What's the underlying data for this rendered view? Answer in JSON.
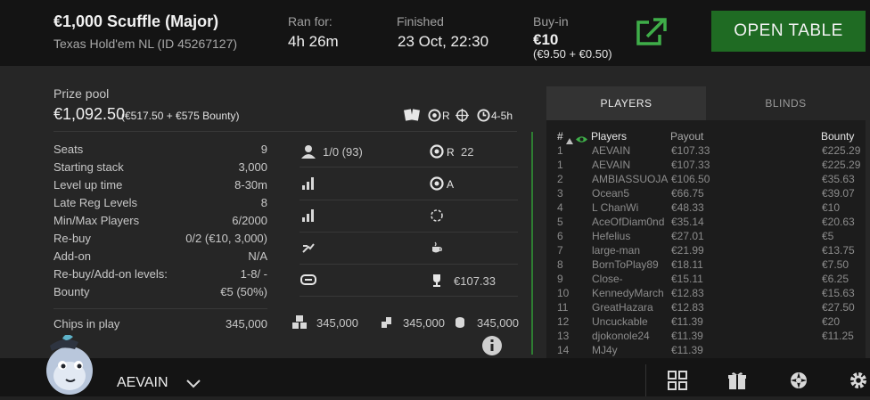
{
  "header": {
    "title": "€1,000 Scuffle (Major)",
    "subtitle": "Texas Hold'em NL (ID 45267127)",
    "ran_for_label": "Ran for:",
    "ran_for_value": "4h 26m",
    "finished_label": "Finished",
    "finished_value": "23 Oct, 22:30",
    "buyin_label": "Buy-in",
    "buyin_value": "€10",
    "buyin_breakdown": "(€9.50 + €0.50)",
    "open_table_label": "OPEN TABLE"
  },
  "prize": {
    "label": "Prize pool",
    "value": "€1,092.50",
    "breakdown": "(€517.50 + €575 Bounty)",
    "badge_r": "R",
    "badge_time": "4-5h"
  },
  "details": [
    {
      "label": "Seats",
      "value": "9"
    },
    {
      "label": "Starting stack",
      "value": "3,000"
    },
    {
      "label": "Level up time",
      "value": "8-30m"
    },
    {
      "label": "Late Reg Levels",
      "value": "8"
    },
    {
      "label": "Min/Max Players",
      "value": "6/2000"
    },
    {
      "label": "Re-buy",
      "value": "0/2 (€10, 3,000)"
    },
    {
      "label": "Add-on",
      "value": "N/A"
    },
    {
      "label": "Re-buy/Add-on levels:",
      "value": "1-8/ -"
    },
    {
      "label": "Bounty",
      "value": "€5 (50%)"
    }
  ],
  "mid_stats": {
    "players_value": "1/0 (93)",
    "rebuy_r": "R",
    "rebuy_count": "22",
    "addon_a": "A",
    "top_prize": "€107.33"
  },
  "chips": {
    "label": "Chips in play",
    "value": "345,000",
    "v1": "345,000",
    "v2": "345,000",
    "v3": "345,000"
  },
  "tabs": {
    "players": "PLAYERS",
    "blinds": "BLINDS"
  },
  "table": {
    "headers": {
      "rank": "#",
      "players": "Players",
      "payout": "Payout",
      "bounty": "Bounty"
    },
    "rows": [
      {
        "rank": "1",
        "name": "AEVAIN",
        "payout": "€107.33",
        "bounty": "€225.29"
      },
      {
        "rank": "1",
        "name": "AEVAIN",
        "payout": "€107.33",
        "bounty": "€225.29"
      },
      {
        "rank": "2",
        "name": "AMBIASSUOJA",
        "payout": "€106.50",
        "bounty": "€35.63"
      },
      {
        "rank": "3",
        "name": "Ocean5",
        "payout": "€66.75",
        "bounty": "€39.07"
      },
      {
        "rank": "4",
        "name": "L ChanWi",
        "payout": "€48.33",
        "bounty": "€10"
      },
      {
        "rank": "5",
        "name": "AceOfDiam0nd",
        "payout": "€35.14",
        "bounty": "€20.63"
      },
      {
        "rank": "6",
        "name": "Hefelius",
        "payout": "€27.01",
        "bounty": "€5"
      },
      {
        "rank": "7",
        "name": "large-man",
        "payout": "€21.99",
        "bounty": "€13.75"
      },
      {
        "rank": "8",
        "name": "BornToPlay89",
        "payout": "€18.11",
        "bounty": "€7.50"
      },
      {
        "rank": "9",
        "name": "Close-",
        "payout": "€15.11",
        "bounty": "€6.25"
      },
      {
        "rank": "10",
        "name": "KennedyMarch",
        "payout": "€12.83",
        "bounty": "€15.63"
      },
      {
        "rank": "11",
        "name": "GreatHazara",
        "payout": "€12.83",
        "bounty": "€27.50"
      },
      {
        "rank": "12",
        "name": "Uncuckable",
        "payout": "€11.39",
        "bounty": "€20"
      },
      {
        "rank": "13",
        "name": "djokonole24",
        "payout": "€11.39",
        "bounty": "€11.25"
      },
      {
        "rank": "14",
        "name": "MJ4y",
        "payout": "€11.39",
        "bounty": ""
      }
    ]
  },
  "footer": {
    "username": "AEVAIN"
  },
  "colors": {
    "accent_green": "#1f6b23",
    "icon_green": "#3fae49",
    "background": "#222222"
  }
}
